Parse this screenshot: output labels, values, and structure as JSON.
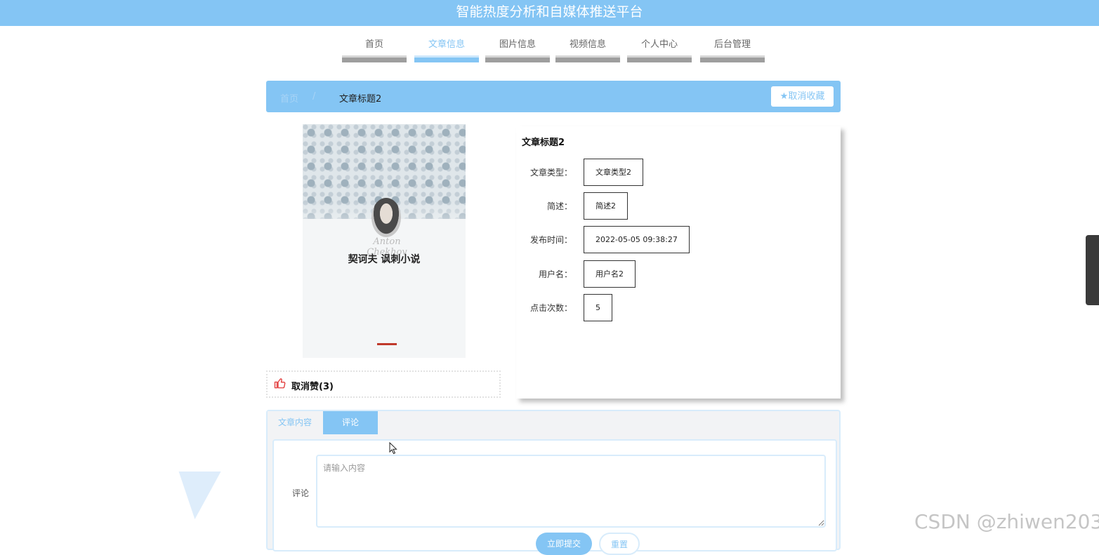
{
  "header": {
    "title": "智能热度分析和自媒体推送平台"
  },
  "nav": {
    "items": [
      {
        "label": "首页"
      },
      {
        "label": "文章信息"
      },
      {
        "label": "图片信息"
      },
      {
        "label": "视频信息"
      },
      {
        "label": "个人中心"
      },
      {
        "label": "后台管理"
      }
    ],
    "active": "文章信息"
  },
  "breadcrumb": {
    "home": "首页",
    "separator": "/",
    "current": "文章标题2"
  },
  "favorite_button": {
    "icon": "star-icon",
    "label": "取消收藏"
  },
  "cover": {
    "title": "契诃夫 讽刺小说",
    "signature": "Anton Chekhov"
  },
  "like": {
    "icon": "thumbs-up-icon",
    "label": "取消赞(3)"
  },
  "article": {
    "title": "文章标题2",
    "fields": [
      {
        "label": "文章类型：",
        "value": "文章类型2"
      },
      {
        "label": "简述：",
        "value": "简述2"
      },
      {
        "label": "发布时间：",
        "value": "2022-05-05 09:38:27"
      },
      {
        "label": "用户名：",
        "value": "用户名2"
      },
      {
        "label": "点击次数：",
        "value": "5"
      }
    ]
  },
  "tabs": [
    {
      "label": "文章内容"
    },
    {
      "label": "评论"
    }
  ],
  "comment_form": {
    "label": "评论",
    "placeholder": "请输入内容",
    "submit_label": "立即提交",
    "reset_label": "重置"
  },
  "watermark": "CSDN @zhiwen203",
  "colors": {
    "accent": "#84c5f4",
    "nav_bar": "#9e9e9e",
    "like_red": "#e23b3b"
  }
}
